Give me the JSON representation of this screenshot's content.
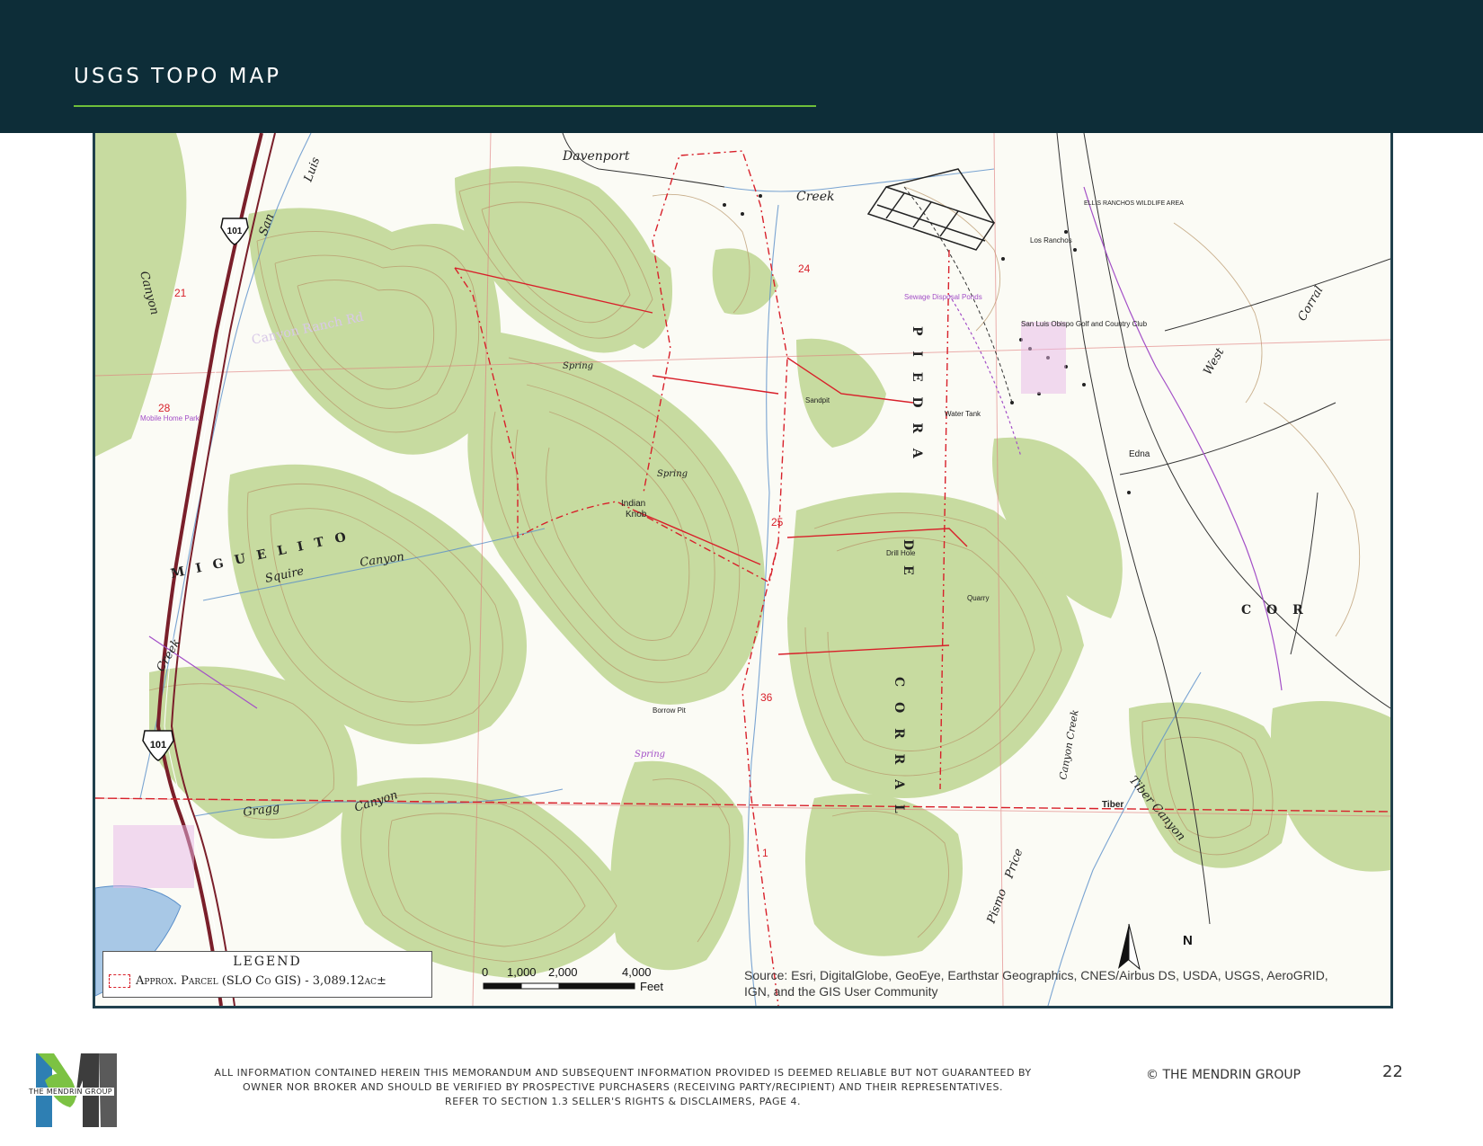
{
  "header": {
    "title": "USGS TOPO MAP"
  },
  "colors": {
    "header_bg": "#0d2d38",
    "accent": "#6fbf3a",
    "vegetation": "#c7dba0",
    "contour": "#b8966a",
    "parcel": "#d8202a",
    "road_purple": "#a34fc7"
  },
  "map": {
    "place_labels": {
      "davenport": "Davenport",
      "creek_top": "Creek",
      "san": "San",
      "luis": "Luis",
      "canyon_left": "Canyon",
      "canyon_ranch_rd": "Canyon Ranch Rd",
      "miguelito": "M I G U E L I T O",
      "squire": "Squire",
      "canyon_squire": "Canyon",
      "creek_left": "Creek",
      "gragg": "Gragg",
      "canyon_gragg": "Canyon",
      "indian_knob": "Indian",
      "knob": "Knob",
      "spring1": "Spring",
      "spring2": "Spring",
      "spring3": "Spring",
      "piedra": "P I E D R A",
      "de": "D E",
      "corral": "C O R R A L",
      "cor_right": "C O R",
      "west": "West",
      "corral_right": "Corral",
      "edna": "Edna",
      "tiber": "Tiber",
      "tiber_canyon": "Tiber Canyon",
      "pismo": "Pismo",
      "price": "Price",
      "canyon_creek": "Canyon Creek",
      "los_ranchos": "Los Ranchos",
      "country_club": "San Luis Obispo Golf and Country Club",
      "sewage": "Sewage Disposal Ponds",
      "water_tank": "Water Tank",
      "quarry": "Quarry",
      "drill_hole": "Drill Hole",
      "sandpit": "Sandpit",
      "borrow_pit": "Borrow Pit",
      "wildlife": "ELLIS RANCHOS WILDLIFE AREA",
      "mobile_home": "Mobile Home Park",
      "hwy_101": "101",
      "sec_24": "24",
      "sec_25": "25",
      "sec_36": "36",
      "sec_1": "1",
      "sec_21": "21",
      "sec_28": "28"
    },
    "legend": {
      "title": "LEGEND",
      "label": "Approx. Parcel (SLO Co GIS) - 3,089.12ac±"
    },
    "scale": {
      "ticks": [
        "0",
        "1,000",
        "2,000",
        "4,000"
      ],
      "unit": "Feet"
    },
    "source": "Source: Esri, DigitalGlobe, GeoEye, Earthstar Geographics, CNES/Airbus DS, USDA, USGS, AeroGRID, IGN, and the GIS User Community",
    "north": "N"
  },
  "footer": {
    "logo_text": "THE MENDRIN GROUP",
    "disclaimer_1": "ALL INFORMATION CONTAINED HEREIN THIS MEMORANDUM AND SUBSEQUENT INFORMATION PROVIDED IS DEEMED RELIABLE BUT NOT GUARANTEED BY",
    "disclaimer_2": "OWNER NOR BROKER AND SHOULD BE VERIFIED BY PROSPECTIVE PURCHASERS (RECEIVING PARTY/RECIPIENT) AND THEIR REPRESENTATIVES.",
    "disclaimer_3": "REFER TO SECTION 1.3 SELLER'S RIGHTS & DISCLAIMERS, PAGE 4.",
    "copyright": "© THE MENDRIN GROUP",
    "page_number": "22"
  }
}
